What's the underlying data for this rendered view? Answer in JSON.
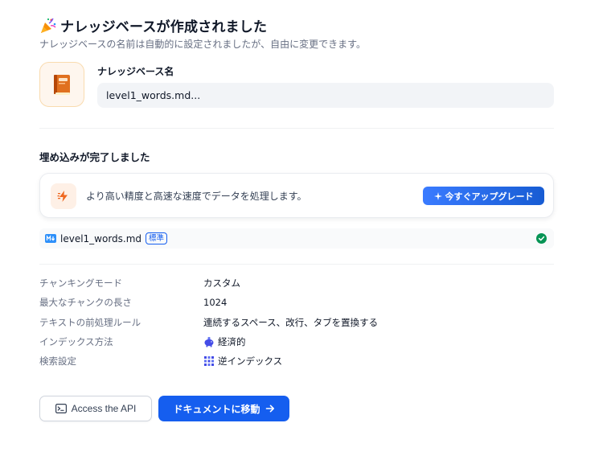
{
  "header": {
    "title": "ナレッジベースが作成されました",
    "subtitle": "ナレッジベースの名前は自動的に設定されましたが、自由に変更できます。"
  },
  "knowledge_base": {
    "name_label": "ナレッジベース名",
    "name_value": "level1_words.md..."
  },
  "embedding": {
    "title": "埋め込みが完了しました",
    "upgrade_text": "より高い精度と高速な速度でデータを処理します。",
    "upgrade_button": "今すぐアップグレード"
  },
  "file": {
    "name": "level1_words.md",
    "badge": "標準",
    "status_icon": "check-circle-icon"
  },
  "settings": [
    {
      "label": "チャンキングモード",
      "value": "カスタム",
      "icon": ""
    },
    {
      "label": "最大なチャンクの長さ",
      "value": "1024",
      "icon": ""
    },
    {
      "label": "テキストの前処理ルール",
      "value": "連続するスペース、改行、タブを置換する",
      "icon": ""
    },
    {
      "label": "インデックス方法",
      "value": "経済的",
      "icon": "piggy-bank-icon"
    },
    {
      "label": "検索設定",
      "value": "逆インデックス",
      "icon": "grid-icon"
    }
  ],
  "actions": {
    "api_button": "Access the API",
    "goto_button": "ドキュメントに移動"
  },
  "colors": {
    "primary": "#155eef",
    "success": "#079455",
    "accent_orange": "#ef6820"
  }
}
